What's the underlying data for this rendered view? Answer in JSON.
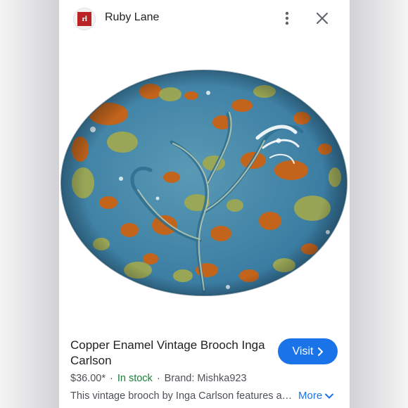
{
  "header": {
    "logo_text": "rl",
    "site_name": "Ruby Lane"
  },
  "product": {
    "title": "Copper Enamel Vintage Brooch Inga Carlson",
    "price": "$36.00*",
    "stock": "In stock",
    "brand": "Brand: Mishka923",
    "description": "This vintage brooch by Inga Carlson features a vibrant copper enamel design",
    "image_alt": "Oval copper enamel brooch with blue, green and orange swirl pattern"
  },
  "actions": {
    "visit_label": "Visit",
    "more_label": "More"
  },
  "icons": {
    "menu": "more-vert-icon",
    "close": "close-icon",
    "visit": "chevron-right-icon",
    "more": "chevron-down-icon"
  },
  "colors": {
    "accent": "#1a73e8",
    "in_stock": "#188038",
    "logo": "#b92323",
    "enamel_blue": "#3d82a8",
    "enamel_orange": "#c3641c",
    "enamel_green": "#a1a950"
  }
}
